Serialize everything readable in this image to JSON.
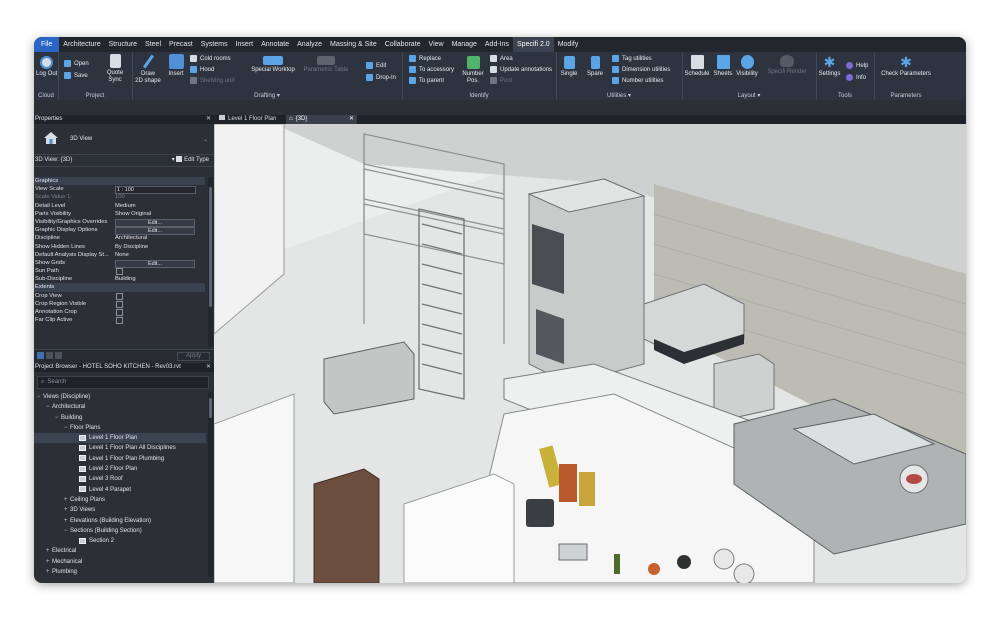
{
  "menu": [
    "File",
    "Architecture",
    "Structure",
    "Steel",
    "Precast",
    "Systems",
    "Insert",
    "Annotate",
    "Analyze",
    "Massing & Site",
    "Collaborate",
    "View",
    "Manage",
    "Add-Ins",
    "Specifi 2.0",
    "Modify"
  ],
  "ribbon": {
    "cloud": {
      "logout": "Log Out",
      "label": "Cloud"
    },
    "project": {
      "open": "Open",
      "save": "Save",
      "quote": "Quote",
      "sync": "Sync",
      "label": "Project"
    },
    "drafting": {
      "draw": "Draw",
      "shape": "2D shape",
      "insert": "Insert",
      "cold_rooms": "Cold rooms",
      "hood": "Hood",
      "shelving": "Shelving unit",
      "special_worktop": "Special Worktop",
      "parametric_table": "Parametric Table",
      "edit": "Edit",
      "drop_in": "Drop-In",
      "label": "Drafting"
    },
    "identify": {
      "replace": "Replace",
      "to_accessory": "To accessory",
      "to_parent": "To parent",
      "number": "Number",
      "pos": "Pos.",
      "area": "Area",
      "update_annotations": "Update annotations",
      "pool": "Pool",
      "label": "Identify"
    },
    "utilities": {
      "single": "Single",
      "spare": "Spare",
      "tag_utilities": "Tag utilities",
      "dimension_utilities": "Dimension utilities",
      "number_utilities": "Number utilities",
      "label": "Utilities"
    },
    "layout": {
      "schedule": "Schedule",
      "sheets": "Sheets",
      "visibility": "Visibility",
      "specifi_render": "Specifi Render",
      "label": "Layout"
    },
    "tools": {
      "settings": "Settings",
      "help": "Help",
      "info": "Info",
      "label": "Tools"
    },
    "parameters": {
      "check": "Check Parameters",
      "label": "Parameters"
    }
  },
  "properties": {
    "title": "Properties",
    "type_name": "3D View",
    "view_selector": "3D View: {3D}",
    "edit_type": "Edit Type",
    "rows": [
      {
        "k": "Graphics",
        "v": "",
        "kind": "section"
      },
      {
        "k": "View Scale",
        "v": "1 : 100",
        "kind": "box"
      },
      {
        "k": "Scale Value    1:",
        "v": "100",
        "kind": "dim"
      },
      {
        "k": "Detail Level",
        "v": "Medium",
        "kind": "text"
      },
      {
        "k": "Parts Visibility",
        "v": "Show Original",
        "kind": "text"
      },
      {
        "k": "Visibility/Graphics Overrides",
        "v": "Edit...",
        "kind": "btn"
      },
      {
        "k": "Graphic Display Options",
        "v": "Edit...",
        "kind": "btn"
      },
      {
        "k": "Discipline",
        "v": "Architectural",
        "kind": "text"
      },
      {
        "k": "Show Hidden Lines",
        "v": "By Discipline",
        "kind": "text"
      },
      {
        "k": "Default Analysis Display St...",
        "v": "None",
        "kind": "text"
      },
      {
        "k": "Show Grids",
        "v": "Edit...",
        "kind": "btn"
      },
      {
        "k": "Sun Path",
        "v": "",
        "kind": "chk"
      },
      {
        "k": "Sub-Discipline",
        "v": "Building",
        "kind": "text"
      },
      {
        "k": "Extents",
        "v": "",
        "kind": "section"
      },
      {
        "k": "Crop View",
        "v": "",
        "kind": "chk"
      },
      {
        "k": "Crop Region Visible",
        "v": "",
        "kind": "chk"
      },
      {
        "k": "Annotation Crop",
        "v": "",
        "kind": "chk"
      },
      {
        "k": "Far Clip Active",
        "v": "",
        "kind": "chk"
      }
    ],
    "apply": "Apply"
  },
  "browser": {
    "title": "Project Browser - HOTEL SOHO KITCHEN - Rev03.rvt",
    "search_placeholder": "Search",
    "tree": [
      {
        "label": "Views (Discipline)",
        "indent": 0,
        "tw": "−",
        "icon": false
      },
      {
        "label": "Architectural",
        "indent": 1,
        "tw": "−",
        "icon": false
      },
      {
        "label": "Building",
        "indent": 2,
        "tw": "−",
        "icon": false
      },
      {
        "label": "Floor Plans",
        "indent": 3,
        "tw": "−",
        "icon": false
      },
      {
        "label": "Level 1 Floor Plan",
        "indent": 4,
        "tw": "",
        "icon": true,
        "sel": true
      },
      {
        "label": "Level 1 Floor Plan All Disciplines",
        "indent": 4,
        "tw": "",
        "icon": true
      },
      {
        "label": "Level 1 Floor Plan Plumbing",
        "indent": 4,
        "tw": "",
        "icon": true
      },
      {
        "label": "Level 2 Floor Plan",
        "indent": 4,
        "tw": "",
        "icon": true
      },
      {
        "label": "Level 3 Roof",
        "indent": 4,
        "tw": "",
        "icon": true
      },
      {
        "label": "Level 4 Parapet",
        "indent": 4,
        "tw": "",
        "icon": true
      },
      {
        "label": "Ceiling Plans",
        "indent": 3,
        "tw": "+",
        "icon": false
      },
      {
        "label": "3D Views",
        "indent": 3,
        "tw": "+",
        "icon": false
      },
      {
        "label": "Elevations (Building Elevation)",
        "indent": 3,
        "tw": "+",
        "icon": false
      },
      {
        "label": "Sections (Building Section)",
        "indent": 3,
        "tw": "−",
        "icon": false
      },
      {
        "label": "Section 2",
        "indent": 4,
        "tw": "",
        "icon": true
      },
      {
        "label": "Electrical",
        "indent": 1,
        "tw": "+",
        "icon": false
      },
      {
        "label": "Mechanical",
        "indent": 1,
        "tw": "+",
        "icon": false
      },
      {
        "label": "Plumbing",
        "indent": 1,
        "tw": "+",
        "icon": false
      }
    ]
  },
  "view_tabs": [
    {
      "label": "Level 1 Floor Plan",
      "active": false
    },
    {
      "label": "{3D}",
      "active": true
    }
  ],
  "colors": {
    "accent": "#2a64c5",
    "ribbon": "#2d3440",
    "panel": "#2b2f36"
  }
}
